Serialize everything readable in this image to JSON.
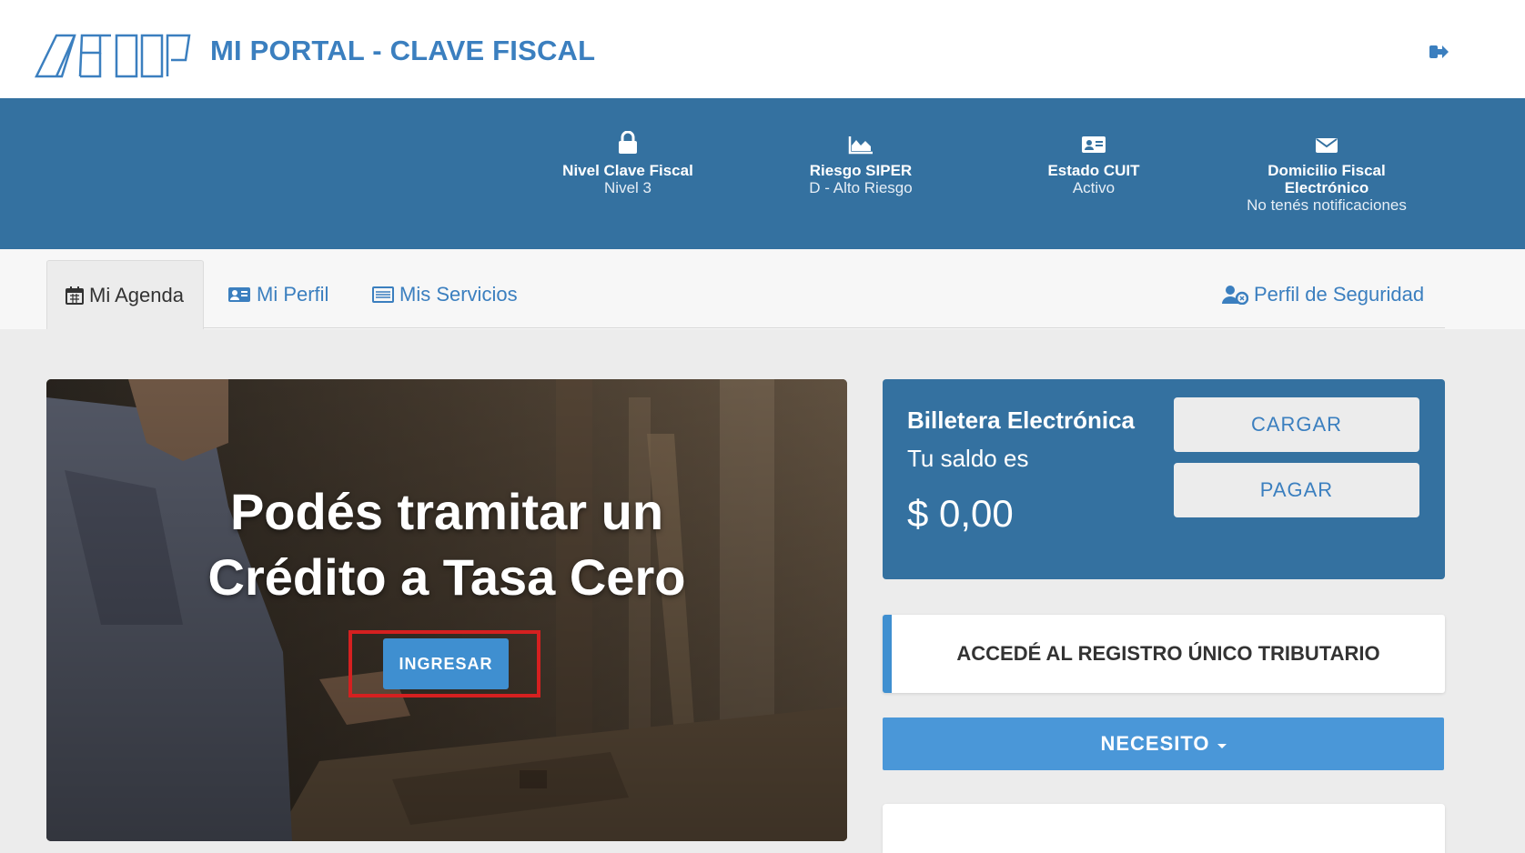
{
  "header": {
    "title": "MI PORTAL - CLAVE FISCAL",
    "logo_icon": "afip-logo",
    "logout_icon": "sign-out-icon"
  },
  "status": [
    {
      "icon": "lock-icon",
      "title": "Nivel Clave Fiscal",
      "value": "Nivel 3"
    },
    {
      "icon": "area-chart-icon",
      "title": "Riesgo SIPER",
      "value": "D - Alto Riesgo"
    },
    {
      "icon": "id-card-icon",
      "title": "Estado CUIT",
      "value": "Activo"
    },
    {
      "icon": "envelope-icon",
      "title_line1": "Domicilio Fiscal",
      "title_line2": "Electrónico",
      "value": "No tenés notificaciones"
    }
  ],
  "tabs": [
    {
      "icon": "calendar-icon",
      "label": "Mi Agenda",
      "active": true
    },
    {
      "icon": "id-card-icon",
      "label": "Mi Perfil"
    },
    {
      "icon": "list-icon",
      "label": "Mis Servicios"
    },
    {
      "icon": "user-lock-icon",
      "label": "Perfil de Seguridad"
    }
  ],
  "banner": {
    "line1": "Podés tramitar un",
    "line2": "Crédito a Tasa Cero",
    "button_label": "INGRESAR"
  },
  "wallet": {
    "title": "Billetera Electrónica",
    "subtitle": "Tu saldo es",
    "amount": "$ 0,00",
    "cargar_label": "CARGAR",
    "pagar_label": "PAGAR"
  },
  "registro": {
    "label": "ACCEDÉ AL REGISTRO ÚNICO TRIBUTARIO"
  },
  "necesito": {
    "label": "NECESITO"
  },
  "colors": {
    "primary_blue": "#3471a0",
    "link_blue": "#3b7fbf",
    "button_blue": "#4a97d8",
    "highlight_red": "#d52020"
  }
}
